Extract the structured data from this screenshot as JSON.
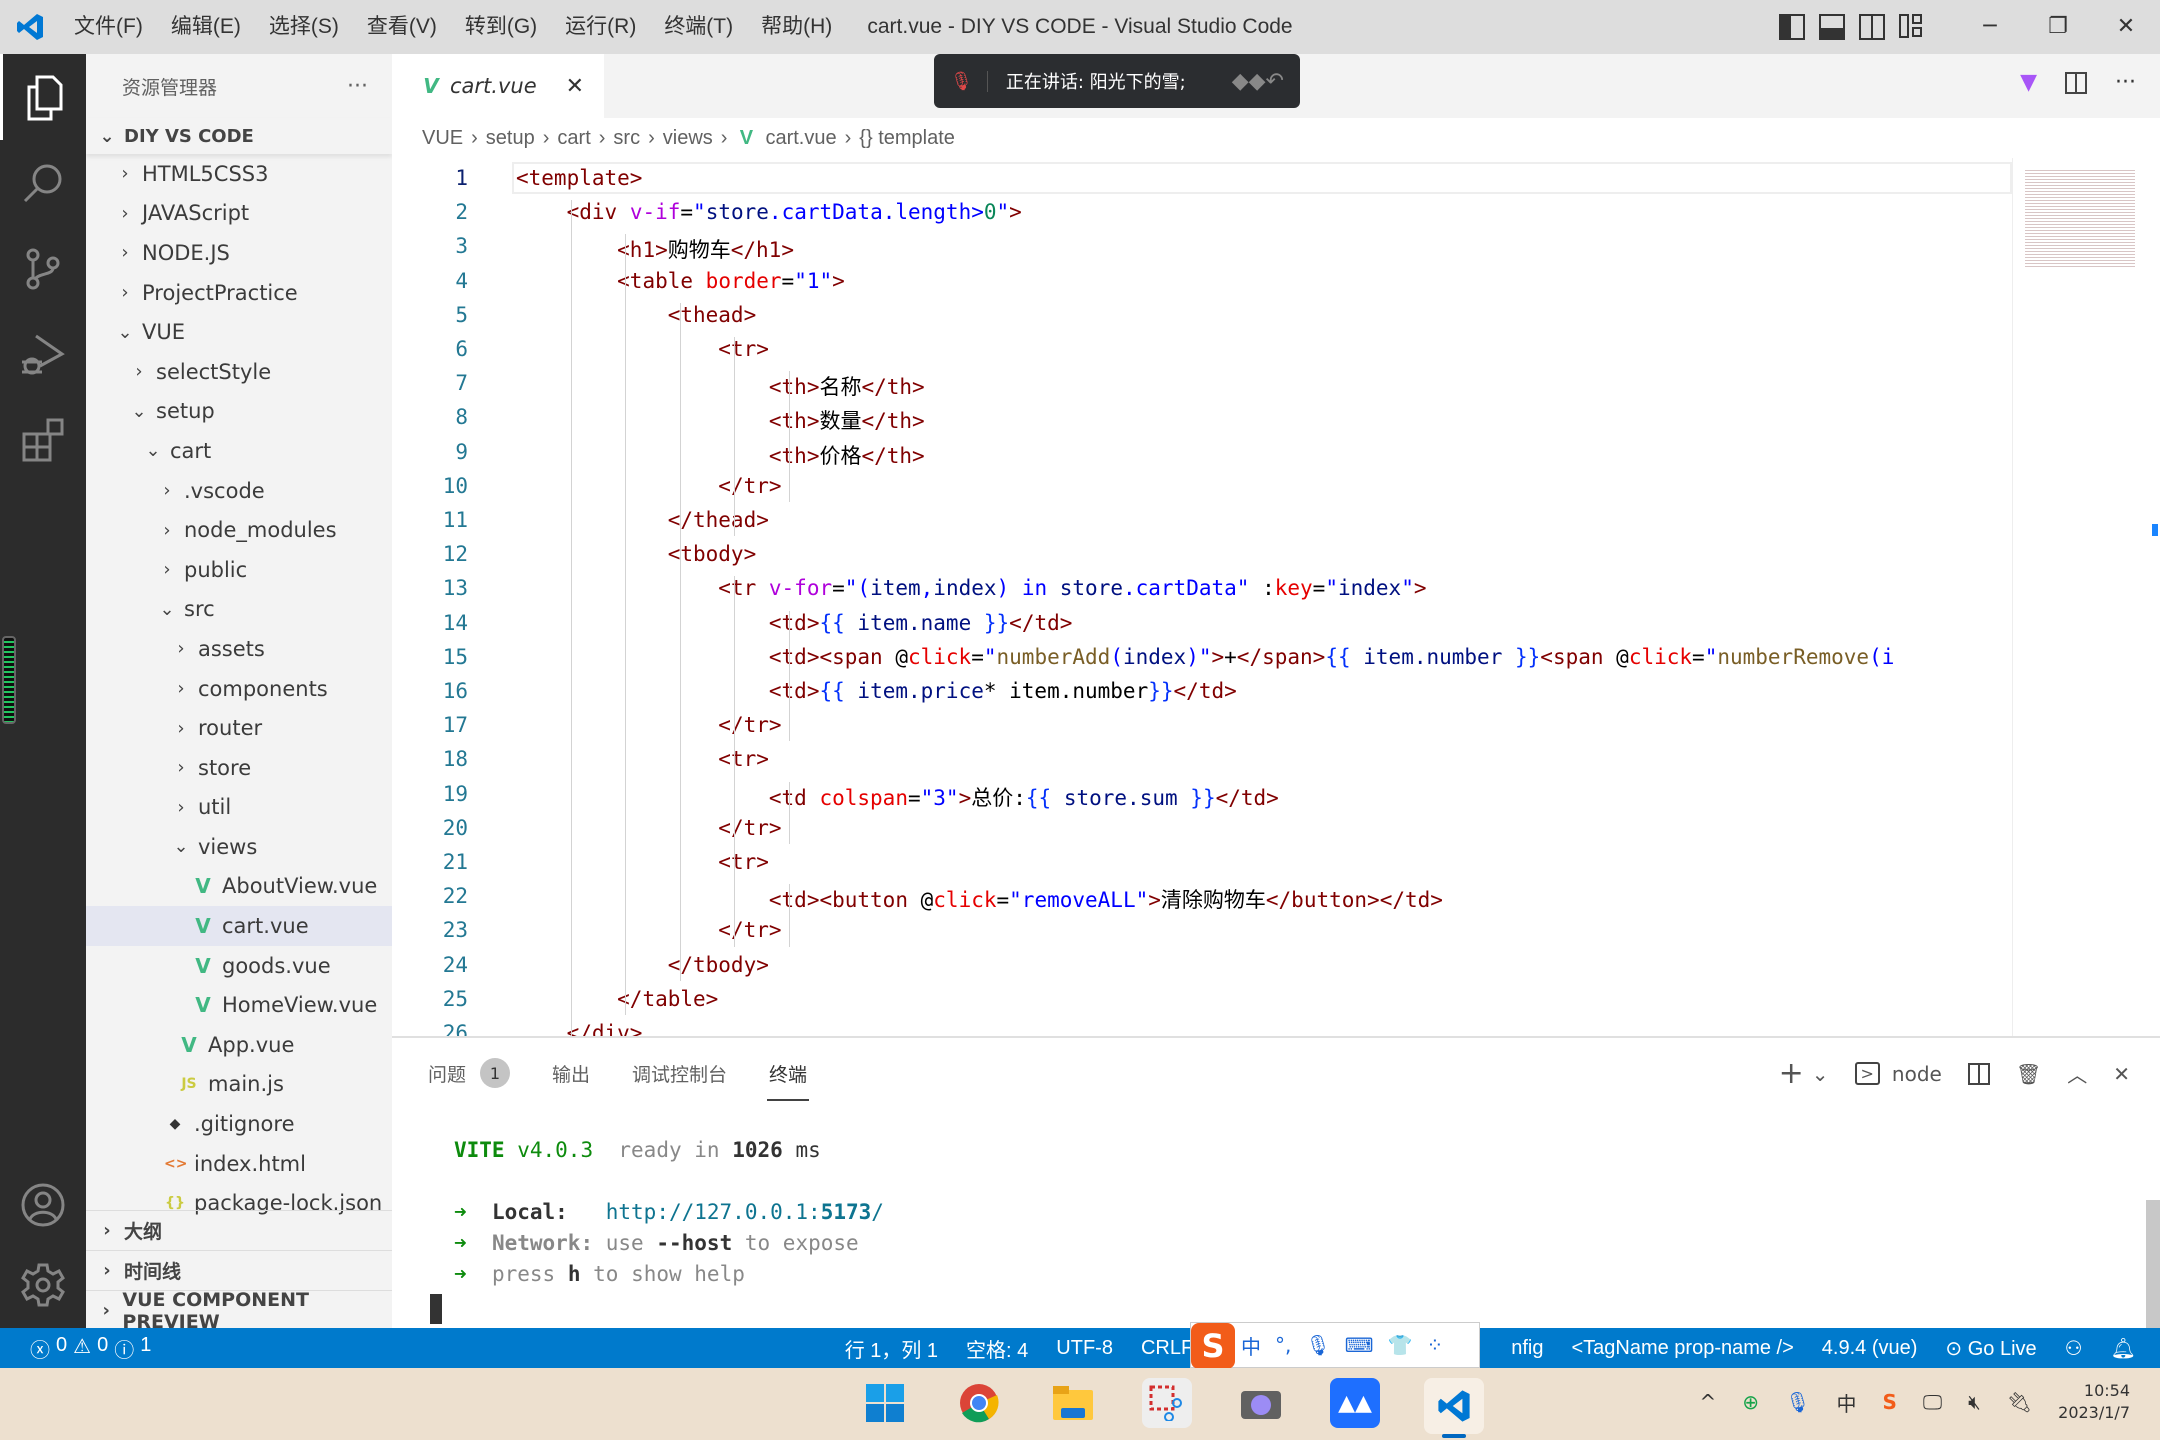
{
  "titlebar": {
    "menu": [
      "文件(F)",
      "编辑(E)",
      "选择(S)",
      "查看(V)",
      "转到(G)",
      "运行(R)",
      "终端(T)",
      "帮助(H)"
    ],
    "title": "cart.vue - DIY VS CODE - Visual Studio Code"
  },
  "sidebar": {
    "title": "资源管理器",
    "more": "···",
    "root": "DIY VS CODE",
    "tree": [
      {
        "label": "HTML5CSS3",
        "depth": 0,
        "type": "folder",
        "open": false
      },
      {
        "label": "JAVAScript",
        "depth": 0,
        "type": "folder",
        "open": false
      },
      {
        "label": "NODE.JS",
        "depth": 0,
        "type": "folder",
        "open": false
      },
      {
        "label": "ProjectPractice",
        "depth": 0,
        "type": "folder",
        "open": false
      },
      {
        "label": "VUE",
        "depth": 0,
        "type": "folder",
        "open": true
      },
      {
        "label": "selectStyle",
        "depth": 1,
        "type": "folder",
        "open": false
      },
      {
        "label": "setup",
        "depth": 1,
        "type": "folder",
        "open": true
      },
      {
        "label": "cart",
        "depth": 2,
        "type": "folder",
        "open": true
      },
      {
        "label": ".vscode",
        "depth": 3,
        "type": "folder",
        "open": false
      },
      {
        "label": "node_modules",
        "depth": 3,
        "type": "folder",
        "open": false
      },
      {
        "label": "public",
        "depth": 3,
        "type": "folder",
        "open": false
      },
      {
        "label": "src",
        "depth": 3,
        "type": "folder",
        "open": true
      },
      {
        "label": "assets",
        "depth": 4,
        "type": "folder",
        "open": false
      },
      {
        "label": "components",
        "depth": 4,
        "type": "folder",
        "open": false
      },
      {
        "label": "router",
        "depth": 4,
        "type": "folder",
        "open": false
      },
      {
        "label": "store",
        "depth": 4,
        "type": "folder",
        "open": false
      },
      {
        "label": "util",
        "depth": 4,
        "type": "folder",
        "open": false
      },
      {
        "label": "views",
        "depth": 4,
        "type": "folder",
        "open": true
      },
      {
        "label": "AboutView.vue",
        "depth": 5,
        "type": "vue"
      },
      {
        "label": "cart.vue",
        "depth": 5,
        "type": "vue",
        "selected": true
      },
      {
        "label": "goods.vue",
        "depth": 5,
        "type": "vue"
      },
      {
        "label": "HomeView.vue",
        "depth": 5,
        "type": "vue"
      },
      {
        "label": "App.vue",
        "depth": 4,
        "type": "vue"
      },
      {
        "label": "main.js",
        "depth": 4,
        "type": "js"
      },
      {
        "label": ".gitignore",
        "depth": 3,
        "type": "git"
      },
      {
        "label": "index.html",
        "depth": 3,
        "type": "html"
      },
      {
        "label": "package-lock.json",
        "depth": 3,
        "type": "json"
      }
    ],
    "sections": [
      "大纲",
      "时间线",
      "VUE COMPONENT PREVIEW"
    ]
  },
  "editor": {
    "tab": "cart.vue",
    "toast": "正在讲话: 阳光下的雪;",
    "breadcrumb": [
      "VUE",
      "setup",
      "cart",
      "src",
      "views",
      "cart.vue",
      "{} template"
    ],
    "lines": [
      "<template>",
      "    <div v-if=\"store.cartData.length>0\">",
      "        <h1>购物车</h1>",
      "        <table border=\"1\">",
      "            <thead>",
      "                <tr>",
      "                    <th>名称</th>",
      "                    <th>数量</th>",
      "                    <th>价格</th>",
      "                </tr>",
      "            </thead>",
      "            <tbody>",
      "                <tr v-for=\"(item,index) in store.cartData\" :key=\"index\">",
      "                    <td>{{ item.name }}</td>",
      "                    <td><span @click=\"numberAdd(index)\">+</span>{{ item.number }}<span @click=\"numberRemove(i",
      "                    <td>{{ item.price* item.number}}</td>",
      "                </tr>",
      "                <tr>",
      "                    <td colspan=\"3\">总价:{{ store.sum }}</td>",
      "                </tr>",
      "                <tr>",
      "                    <td><button @click=\"removeALL\">清除购物车</button></td>",
      "                </tr>",
      "            </tbody>",
      "        </table>",
      "    </div>"
    ]
  },
  "panel": {
    "tabs": [
      "问题",
      "输出",
      "调试控制台",
      "终端"
    ],
    "problems_count": "1",
    "active_tab": "终端",
    "terminal_name": "node",
    "terminal": {
      "vite": "VITE",
      "version": "v4.0.3",
      "ready": "ready in",
      "ms_value": "1026",
      "ms": "ms",
      "local_label": "Local:",
      "local_url_prefix": "http://127.0.0.1:",
      "local_port": "5173",
      "local_url_suffix": "/",
      "network_label": "Network:",
      "network_use": "use",
      "network_flag": "--host",
      "network_rest": "to expose",
      "press": "press",
      "press_key": "h",
      "press_rest": "to show help",
      "arrow": "➜"
    }
  },
  "statusbar": {
    "errors": "0",
    "warnings": "0",
    "info": "1",
    "position": "行 1，列 1",
    "spaces": "空格: 4",
    "encoding": "UTF-8",
    "eol": "CRLF",
    "config": "nfig",
    "tagname": "<TagName prop-name />",
    "version": "4.9.4 (vue)",
    "golive": "Go Live"
  },
  "ime": {
    "lang": "中",
    "punct": "°,"
  },
  "taskbar": {
    "apps": [
      "start",
      "chrome",
      "file-explorer",
      "snipping-tool",
      "camera",
      "meeting",
      "vscode"
    ],
    "time": "10:54",
    "date": "2023/1/7",
    "tray_ime": "中"
  }
}
